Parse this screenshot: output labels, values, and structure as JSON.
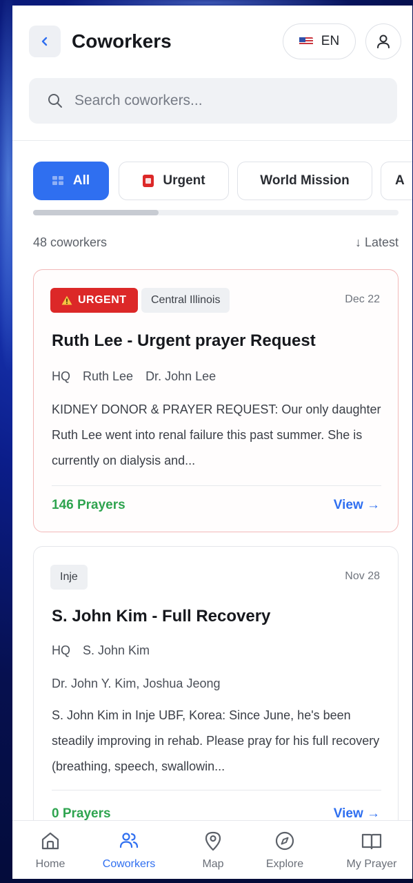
{
  "header": {
    "title": "Coworkers",
    "language": "EN"
  },
  "search": {
    "placeholder": "Search coworkers..."
  },
  "filters": [
    {
      "label": "All",
      "active": true,
      "icon": "grid-icon"
    },
    {
      "label": "Urgent",
      "active": false,
      "icon": "urgent-icon"
    },
    {
      "label": "World Mission",
      "active": false
    },
    {
      "label": "A",
      "active": false
    }
  ],
  "list": {
    "count_text": "48 coworkers",
    "sort_text": "↓ Latest"
  },
  "cards": [
    {
      "badge": "URGENT",
      "region": "Central Illinois",
      "date": "Dec 22",
      "title": "Ruth Lee - Urgent prayer Request",
      "meta": [
        "HQ",
        "Ruth Lee",
        "Dr. John Lee"
      ],
      "body": "KIDNEY DONOR & PRAYER REQUEST: Our only daughter Ruth Lee went into renal failure this past summer. She is currently on dialysis and...",
      "prayers": "146 Prayers",
      "view": "View →"
    },
    {
      "region": "Inje",
      "date": "Nov 28",
      "title": "S. John Kim - Full Recovery",
      "meta": [
        "HQ",
        "S. John Kim"
      ],
      "meta2": "Dr. John Y. Kim, Joshua Jeong",
      "body": "S. John Kim in Inje UBF, Korea: Since June, he's been steadily improving in rehab. Please pray for his full recovery (breathing, speech, swallowin...",
      "prayers": "0 Prayers",
      "view": "View →"
    }
  ],
  "nav": [
    {
      "label": "Home",
      "icon": "home-icon"
    },
    {
      "label": "Coworkers",
      "icon": "users-icon",
      "active": true
    },
    {
      "label": "Map",
      "icon": "map-pin-icon"
    },
    {
      "label": "Explore",
      "icon": "compass-icon"
    },
    {
      "label": "My Prayer",
      "icon": "book-icon"
    }
  ],
  "colors": {
    "accent": "#2f6ff0",
    "urgent": "#dc2828",
    "prayers": "#2ea44f"
  }
}
